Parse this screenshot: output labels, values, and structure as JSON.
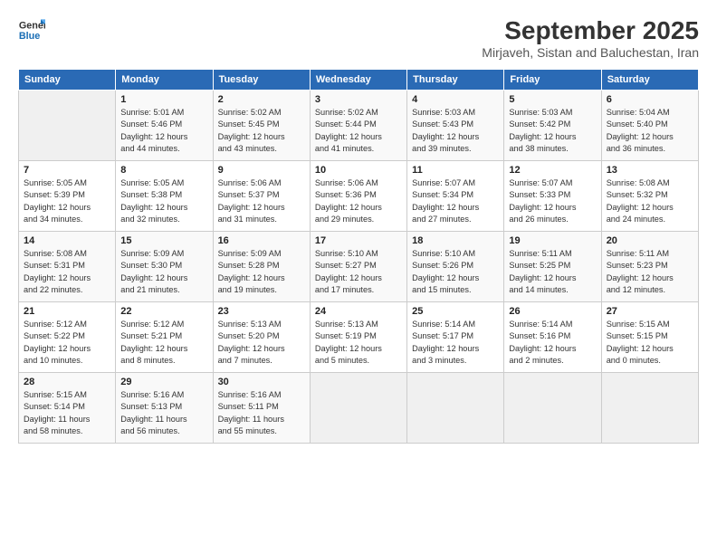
{
  "header": {
    "logo_line1": "General",
    "logo_line2": "Blue",
    "month": "September 2025",
    "location": "Mirjaveh, Sistan and Baluchestan, Iran"
  },
  "weekdays": [
    "Sunday",
    "Monday",
    "Tuesday",
    "Wednesday",
    "Thursday",
    "Friday",
    "Saturday"
  ],
  "weeks": [
    [
      {
        "day": "",
        "detail": ""
      },
      {
        "day": "1",
        "detail": "Sunrise: 5:01 AM\nSunset: 5:46 PM\nDaylight: 12 hours\nand 44 minutes."
      },
      {
        "day": "2",
        "detail": "Sunrise: 5:02 AM\nSunset: 5:45 PM\nDaylight: 12 hours\nand 43 minutes."
      },
      {
        "day": "3",
        "detail": "Sunrise: 5:02 AM\nSunset: 5:44 PM\nDaylight: 12 hours\nand 41 minutes."
      },
      {
        "day": "4",
        "detail": "Sunrise: 5:03 AM\nSunset: 5:43 PM\nDaylight: 12 hours\nand 39 minutes."
      },
      {
        "day": "5",
        "detail": "Sunrise: 5:03 AM\nSunset: 5:42 PM\nDaylight: 12 hours\nand 38 minutes."
      },
      {
        "day": "6",
        "detail": "Sunrise: 5:04 AM\nSunset: 5:40 PM\nDaylight: 12 hours\nand 36 minutes."
      }
    ],
    [
      {
        "day": "7",
        "detail": "Sunrise: 5:05 AM\nSunset: 5:39 PM\nDaylight: 12 hours\nand 34 minutes."
      },
      {
        "day": "8",
        "detail": "Sunrise: 5:05 AM\nSunset: 5:38 PM\nDaylight: 12 hours\nand 32 minutes."
      },
      {
        "day": "9",
        "detail": "Sunrise: 5:06 AM\nSunset: 5:37 PM\nDaylight: 12 hours\nand 31 minutes."
      },
      {
        "day": "10",
        "detail": "Sunrise: 5:06 AM\nSunset: 5:36 PM\nDaylight: 12 hours\nand 29 minutes."
      },
      {
        "day": "11",
        "detail": "Sunrise: 5:07 AM\nSunset: 5:34 PM\nDaylight: 12 hours\nand 27 minutes."
      },
      {
        "day": "12",
        "detail": "Sunrise: 5:07 AM\nSunset: 5:33 PM\nDaylight: 12 hours\nand 26 minutes."
      },
      {
        "day": "13",
        "detail": "Sunrise: 5:08 AM\nSunset: 5:32 PM\nDaylight: 12 hours\nand 24 minutes."
      }
    ],
    [
      {
        "day": "14",
        "detail": "Sunrise: 5:08 AM\nSunset: 5:31 PM\nDaylight: 12 hours\nand 22 minutes."
      },
      {
        "day": "15",
        "detail": "Sunrise: 5:09 AM\nSunset: 5:30 PM\nDaylight: 12 hours\nand 21 minutes."
      },
      {
        "day": "16",
        "detail": "Sunrise: 5:09 AM\nSunset: 5:28 PM\nDaylight: 12 hours\nand 19 minutes."
      },
      {
        "day": "17",
        "detail": "Sunrise: 5:10 AM\nSunset: 5:27 PM\nDaylight: 12 hours\nand 17 minutes."
      },
      {
        "day": "18",
        "detail": "Sunrise: 5:10 AM\nSunset: 5:26 PM\nDaylight: 12 hours\nand 15 minutes."
      },
      {
        "day": "19",
        "detail": "Sunrise: 5:11 AM\nSunset: 5:25 PM\nDaylight: 12 hours\nand 14 minutes."
      },
      {
        "day": "20",
        "detail": "Sunrise: 5:11 AM\nSunset: 5:23 PM\nDaylight: 12 hours\nand 12 minutes."
      }
    ],
    [
      {
        "day": "21",
        "detail": "Sunrise: 5:12 AM\nSunset: 5:22 PM\nDaylight: 12 hours\nand 10 minutes."
      },
      {
        "day": "22",
        "detail": "Sunrise: 5:12 AM\nSunset: 5:21 PM\nDaylight: 12 hours\nand 8 minutes."
      },
      {
        "day": "23",
        "detail": "Sunrise: 5:13 AM\nSunset: 5:20 PM\nDaylight: 12 hours\nand 7 minutes."
      },
      {
        "day": "24",
        "detail": "Sunrise: 5:13 AM\nSunset: 5:19 PM\nDaylight: 12 hours\nand 5 minutes."
      },
      {
        "day": "25",
        "detail": "Sunrise: 5:14 AM\nSunset: 5:17 PM\nDaylight: 12 hours\nand 3 minutes."
      },
      {
        "day": "26",
        "detail": "Sunrise: 5:14 AM\nSunset: 5:16 PM\nDaylight: 12 hours\nand 2 minutes."
      },
      {
        "day": "27",
        "detail": "Sunrise: 5:15 AM\nSunset: 5:15 PM\nDaylight: 12 hours\nand 0 minutes."
      }
    ],
    [
      {
        "day": "28",
        "detail": "Sunrise: 5:15 AM\nSunset: 5:14 PM\nDaylight: 11 hours\nand 58 minutes."
      },
      {
        "day": "29",
        "detail": "Sunrise: 5:16 AM\nSunset: 5:13 PM\nDaylight: 11 hours\nand 56 minutes."
      },
      {
        "day": "30",
        "detail": "Sunrise: 5:16 AM\nSunset: 5:11 PM\nDaylight: 11 hours\nand 55 minutes."
      },
      {
        "day": "",
        "detail": ""
      },
      {
        "day": "",
        "detail": ""
      },
      {
        "day": "",
        "detail": ""
      },
      {
        "day": "",
        "detail": ""
      }
    ]
  ]
}
